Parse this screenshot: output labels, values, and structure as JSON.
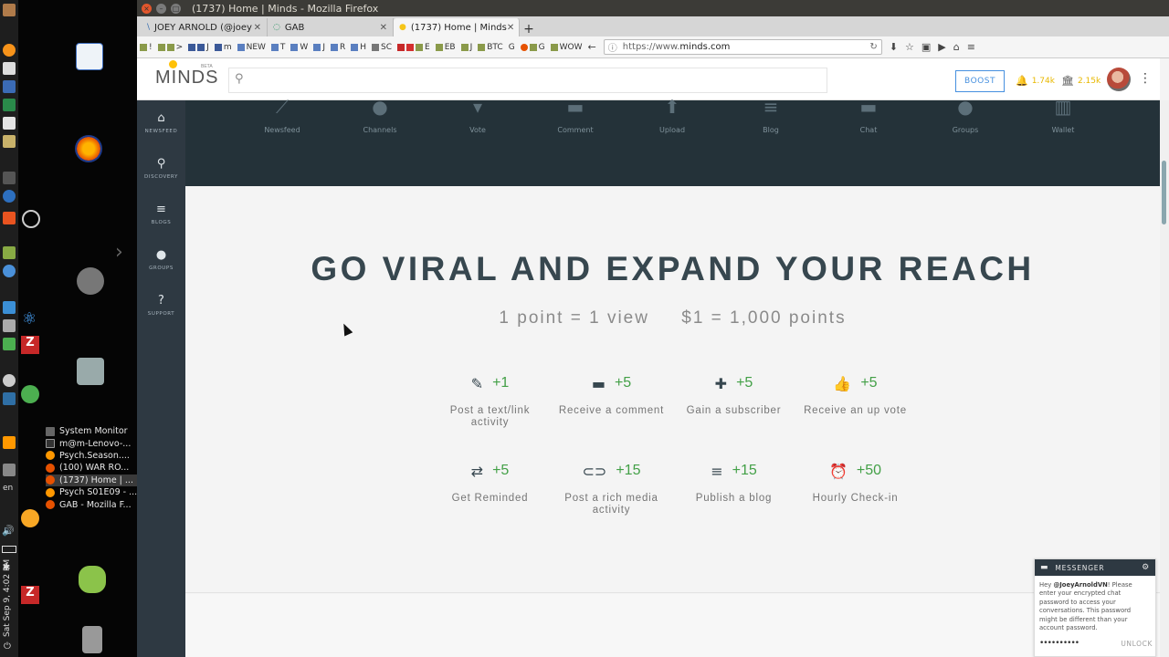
{
  "window": {
    "title": "(1737) Home | Minds - Mozilla Firefox"
  },
  "tabs": [
    {
      "label": "JOEY ARNOLD (@joey",
      "icon": "twitter-icon",
      "active": false
    },
    {
      "label": "GAB",
      "icon": "gab-icon",
      "active": false
    },
    {
      "label": "(1737) Home | Minds",
      "icon": "minds-icon",
      "active": true
    }
  ],
  "bookmarks": [
    "!",
    ">",
    "J",
    "m",
    "NEW",
    "T",
    "W",
    "J",
    "R",
    "H",
    "SC",
    "E",
    "EB",
    "J",
    "BTC",
    "G",
    "G",
    "WOW"
  ],
  "url": {
    "prefix": "https://www.",
    "domain": "minds.com"
  },
  "topbar": {
    "logo": "MINDS",
    "logo_tag": "BETA",
    "boost_label": "BOOST",
    "notifications": "1.74k",
    "wallet": "2.15k"
  },
  "sidenav": [
    {
      "label": "NEWSFEED",
      "icon": "home-icon"
    },
    {
      "label": "DISCOVERY",
      "icon": "search-icon"
    },
    {
      "label": "BLOGS",
      "icon": "blog-icon"
    },
    {
      "label": "GROUPS",
      "icon": "groups-icon"
    },
    {
      "label": "SUPPORT",
      "icon": "help-icon"
    }
  ],
  "hero_icons": [
    "Newsfeed",
    "Channels",
    "Vote",
    "Comment",
    "Upload",
    "Blog",
    "Chat",
    "Groups",
    "Wallet"
  ],
  "content": {
    "headline": "GO VIRAL AND EXPAND YOUR REACH",
    "rate_views": "1 point = 1 view",
    "rate_dollars": "$1 = 1,000 points",
    "rewards": [
      {
        "icon": "pencil-icon",
        "points": "+1",
        "label": "Post a text/link activity"
      },
      {
        "icon": "comment-icon",
        "points": "+5",
        "label": "Receive a comment"
      },
      {
        "icon": "add-person-icon",
        "points": "+5",
        "label": "Gain a subscriber"
      },
      {
        "icon": "thumbs-up-icon",
        "points": "+5",
        "label": "Receive an up vote"
      },
      {
        "icon": "repeat-icon",
        "points": "+5",
        "label": "Get Reminded"
      },
      {
        "icon": "paperclip-icon",
        "points": "+15",
        "label": "Post a rich media activity"
      },
      {
        "icon": "list-icon",
        "points": "+15",
        "label": "Publish a blog"
      },
      {
        "icon": "alarm-icon",
        "points": "+50",
        "label": "Hourly Check-in"
      }
    ]
  },
  "messenger": {
    "title": "MESSENGER",
    "greeting": "Hey ",
    "handle": "@JoeyArnoldVN",
    "message": "! Please enter your encrypted chat password to access your conversations. This password might be different than your account password.",
    "password_value": "••••••••••",
    "unlock_label": "UNLOCK"
  },
  "desktop": {
    "taskmenu": [
      "System Monitor",
      "m@m-Lenovo-...",
      "Psych.Season....",
      "(100) WAR RO...",
      "(1737) Home | ...",
      "Psych S01E09 - ...",
      "GAB - Mozilla F..."
    ],
    "clock": "Sat Sep 9, 4:02 PM",
    "lang": "en"
  }
}
